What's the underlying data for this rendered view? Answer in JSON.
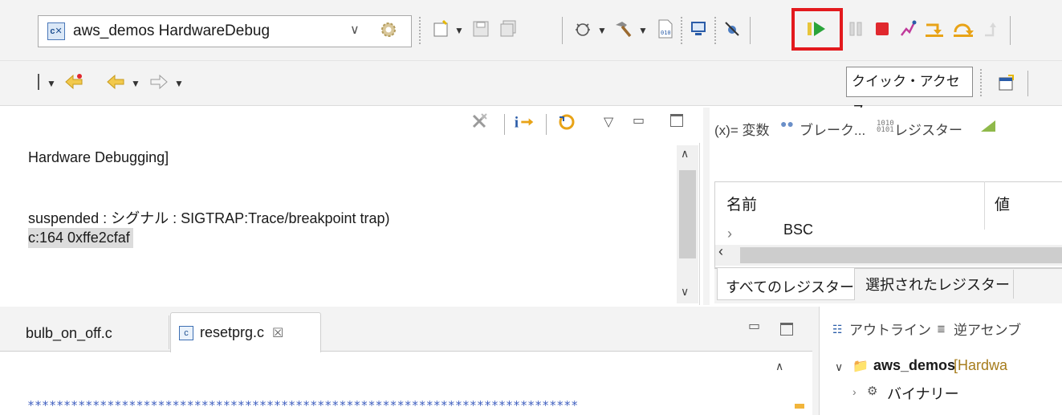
{
  "toolbar": {
    "launch_config": "aws_demos HardwareDebug",
    "quick_access": "クイック・アクセス"
  },
  "debug_view": {
    "lines": [
      "Hardware Debugging]",
      "suspended : シグナル : SIGTRAP:Trace/breakpoint trap)",
      "c:164 0xffe2cfaf"
    ]
  },
  "registers_view": {
    "tabs": [
      "(x)= 変数",
      "ブレーク...",
      "レジスター"
    ],
    "columns": [
      "名前",
      "値"
    ],
    "rows": [
      "BSC"
    ],
    "subtabs": [
      "すべてのレジスター",
      "選択されたレジスター"
    ]
  },
  "editor": {
    "tabs": [
      "bulb_on_off.c",
      "resetprg.c"
    ],
    "active_tab_index": 1,
    "code_line": "****************************************************************************"
  },
  "outline_view": {
    "tabs": [
      "アウトライン",
      "逆アセンブ"
    ],
    "tree": [
      {
        "label": "aws_demos",
        "suffix": "[Hardwa"
      },
      {
        "label": "バイナリー"
      }
    ]
  },
  "colors": {
    "highlight": "#e3191d",
    "play_green": "#2aa43a",
    "terminate_red": "#e0282e"
  }
}
